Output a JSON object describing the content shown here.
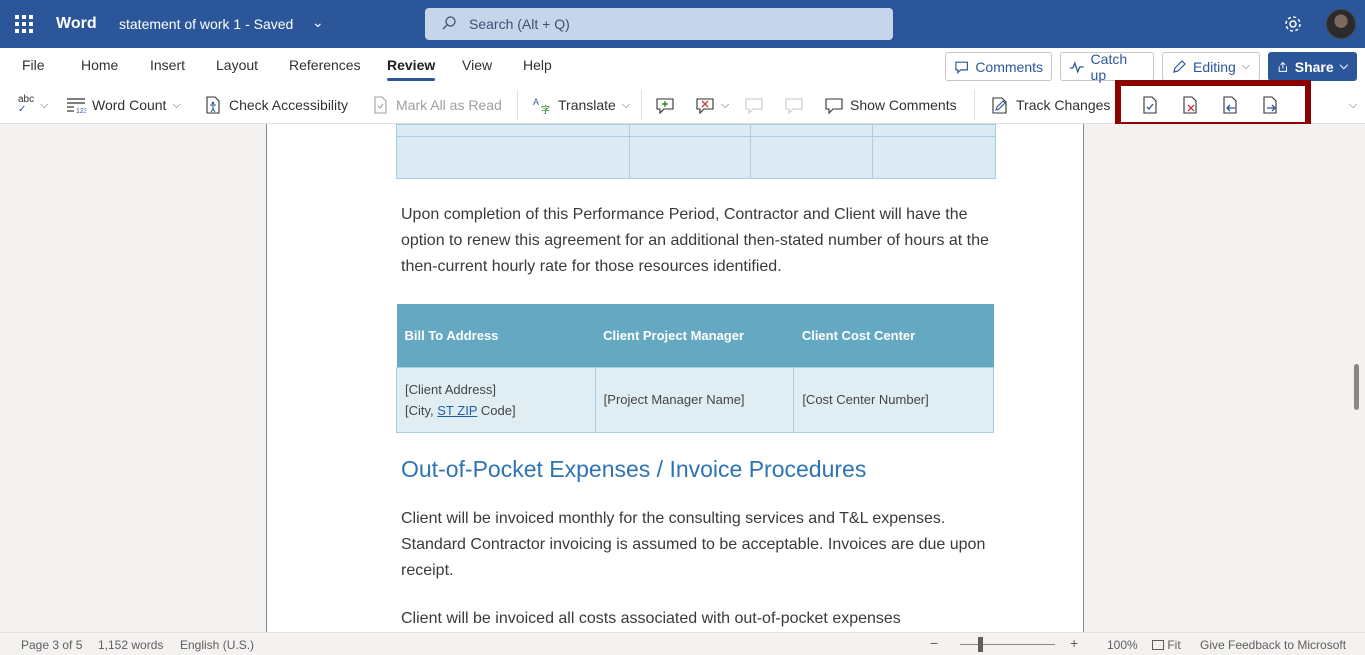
{
  "titlebar": {
    "app_name": "Word",
    "document_name": "statement of work 1",
    "separator": "-",
    "save_status": "Saved",
    "search_placeholder": "Search (Alt + Q)"
  },
  "tabs": [
    "File",
    "Home",
    "Insert",
    "Layout",
    "References",
    "Review",
    "View",
    "Help"
  ],
  "active_tab": "Review",
  "header_buttons": {
    "comments": "Comments",
    "catch_up": "Catch up",
    "editing": "Editing",
    "share": "Share"
  },
  "ribbon": {
    "spelling_label": "abc",
    "word_count": "Word Count",
    "check_accessibility": "Check Accessibility",
    "mark_all_read": "Mark All as Read",
    "translate": "Translate",
    "show_comments": "Show Comments",
    "track_changes": "Track Changes"
  },
  "document": {
    "para1": "Upon completion of this Performance Period, Contractor and Client will have the option to renew this agreement for an additional then-stated number of hours at the then-current hourly rate for those resources identified.",
    "table_headers": [
      "Bill To Address",
      "Client Project Manager",
      "Client Cost Center"
    ],
    "address_line1": "[Client Address]",
    "address_line2_prefix": "[City, ",
    "address_line2_link": "ST  ZIP",
    "address_line2_suffix": " Code]",
    "project_manager": "[Project Manager Name]",
    "cost_center": "[Cost Center Number]",
    "heading": "Out-of-Pocket Expenses / Invoice Procedures",
    "para2": "Client will be invoiced monthly for the consulting services and T&L expenses. Standard Contractor invoicing is assumed to be acceptable. Invoices are due upon receipt.",
    "para3": "Client will be invoiced all costs associated with out-of-pocket expenses"
  },
  "statusbar": {
    "page": "Page 3 of 5",
    "words": "1,152 words",
    "language": "English (U.S.)",
    "zoom_minus": "−",
    "zoom_plus": "+",
    "zoom": "100%",
    "fit": "Fit",
    "feedback": "Give Feedback to Microsoft"
  },
  "colors": {
    "brand": "#2b579a",
    "highlight_box": "#8b0000",
    "table_header": "#64a9c1",
    "heading": "#2e74b5"
  }
}
